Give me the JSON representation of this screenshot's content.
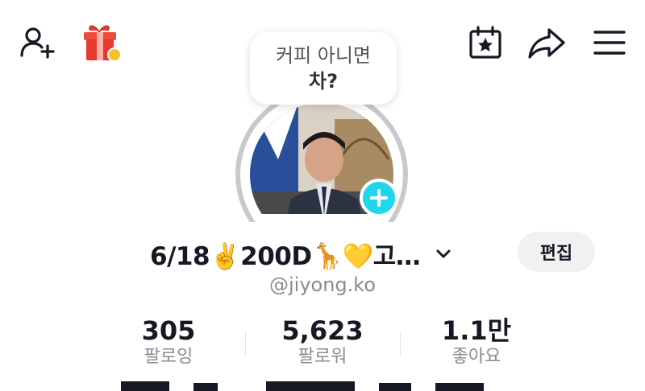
{
  "note": {
    "line1": "커피 아니면",
    "line2": "차?"
  },
  "profile": {
    "display_name": "6/18✌️200D🦒💛고…",
    "username": "@jiyong.ko",
    "edit_label": "편집"
  },
  "stats": [
    {
      "value": "305",
      "label": "팔로잉"
    },
    {
      "value": "5,623",
      "label": "팔로워"
    },
    {
      "value": "1.1만",
      "label": "좋아요"
    }
  ],
  "icons": {
    "add_friend": "person-add-icon",
    "gift": "gift-icon",
    "calendar": "calendar-star-icon",
    "share": "share-arrow-icon",
    "menu": "hamburger-menu-icon",
    "expand": "chevron-down-icon",
    "add_story": "plus-icon"
  },
  "colors": {
    "accent": "#20d5ec",
    "text": "#161823",
    "muted": "#8a8b91",
    "edit_bg": "#f1f1f2"
  }
}
